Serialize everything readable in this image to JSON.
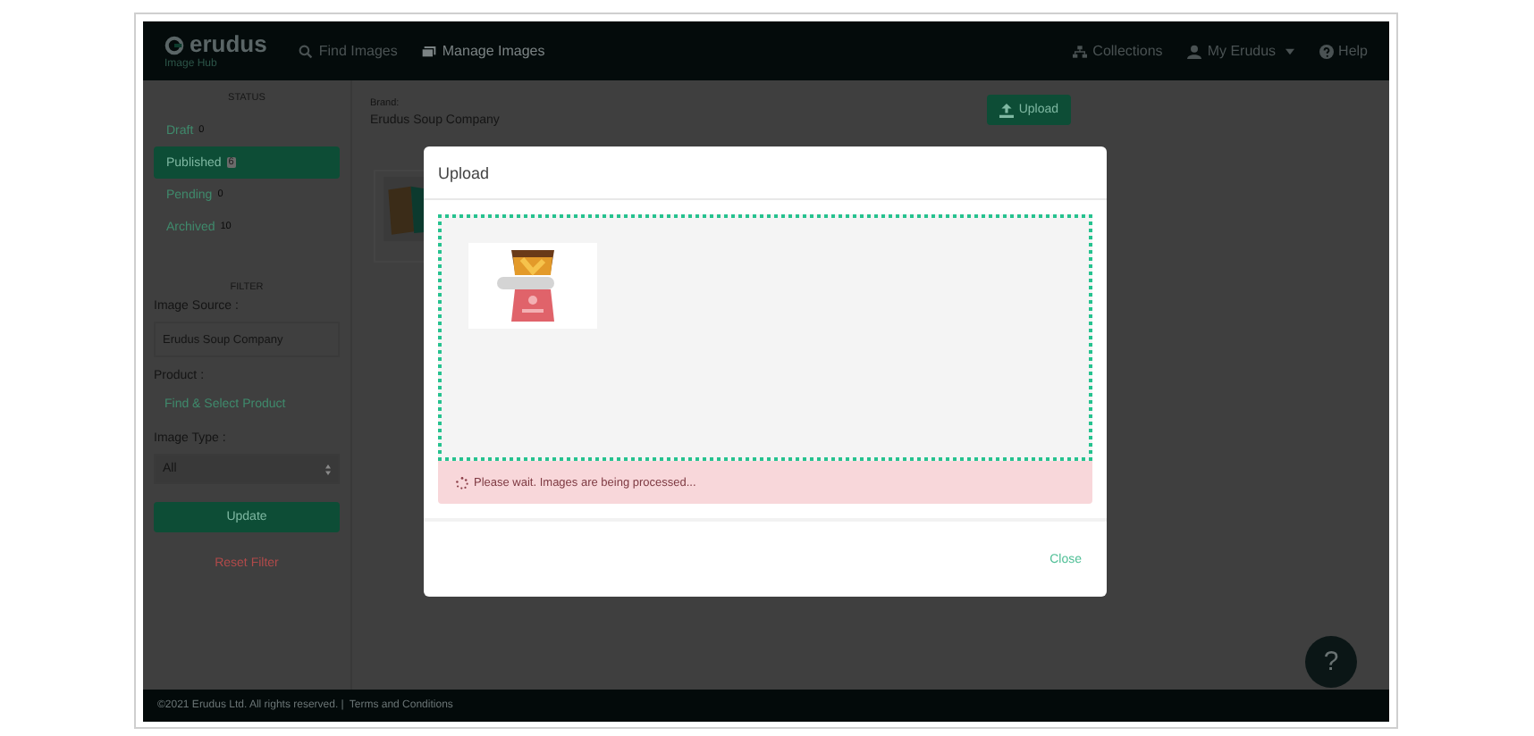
{
  "navbar": {
    "logo": "erudus",
    "subtitle": "Image Hub",
    "links": [
      {
        "label": "Find Images",
        "selected": false
      },
      {
        "label": "Manage Images",
        "selected": true
      }
    ],
    "right_links": [
      {
        "label": "Collections",
        "dropdown": false
      },
      {
        "label": "My Erudus",
        "dropdown": true
      },
      {
        "label": "Help",
        "dropdown": false
      }
    ]
  },
  "sidebar": {
    "status_heading": "STATUS",
    "statuses": [
      {
        "label": "Draft",
        "count": "0",
        "selected": false
      },
      {
        "label": "Published",
        "count": "6",
        "selected": true
      },
      {
        "label": "Pending",
        "count": "0",
        "selected": false
      },
      {
        "label": "Archived",
        "count": "10",
        "selected": false
      }
    ],
    "filter_heading": "FILTER",
    "image_source_label": "Image Source :",
    "image_source_value": "Erudus Soup Company",
    "product_label": "Product :",
    "product_link": "Find & Select Product",
    "image_type_label": "Image Type :",
    "image_type_value": "All",
    "update_button": "Update",
    "reset_link": "Reset Filter"
  },
  "main": {
    "brand_label": "Brand:",
    "brand_value": "Erudus Soup Company",
    "upload_button": "Upload"
  },
  "modal": {
    "title": "Upload",
    "alert": "Please wait. Images are being processed...",
    "close_button": "Close"
  },
  "footer": {
    "copyright": "©2021 Erudus Ltd. All rights reserved.",
    "separator": "|",
    "terms_link": "Terms and Conditions"
  },
  "help_bubble": "?"
}
